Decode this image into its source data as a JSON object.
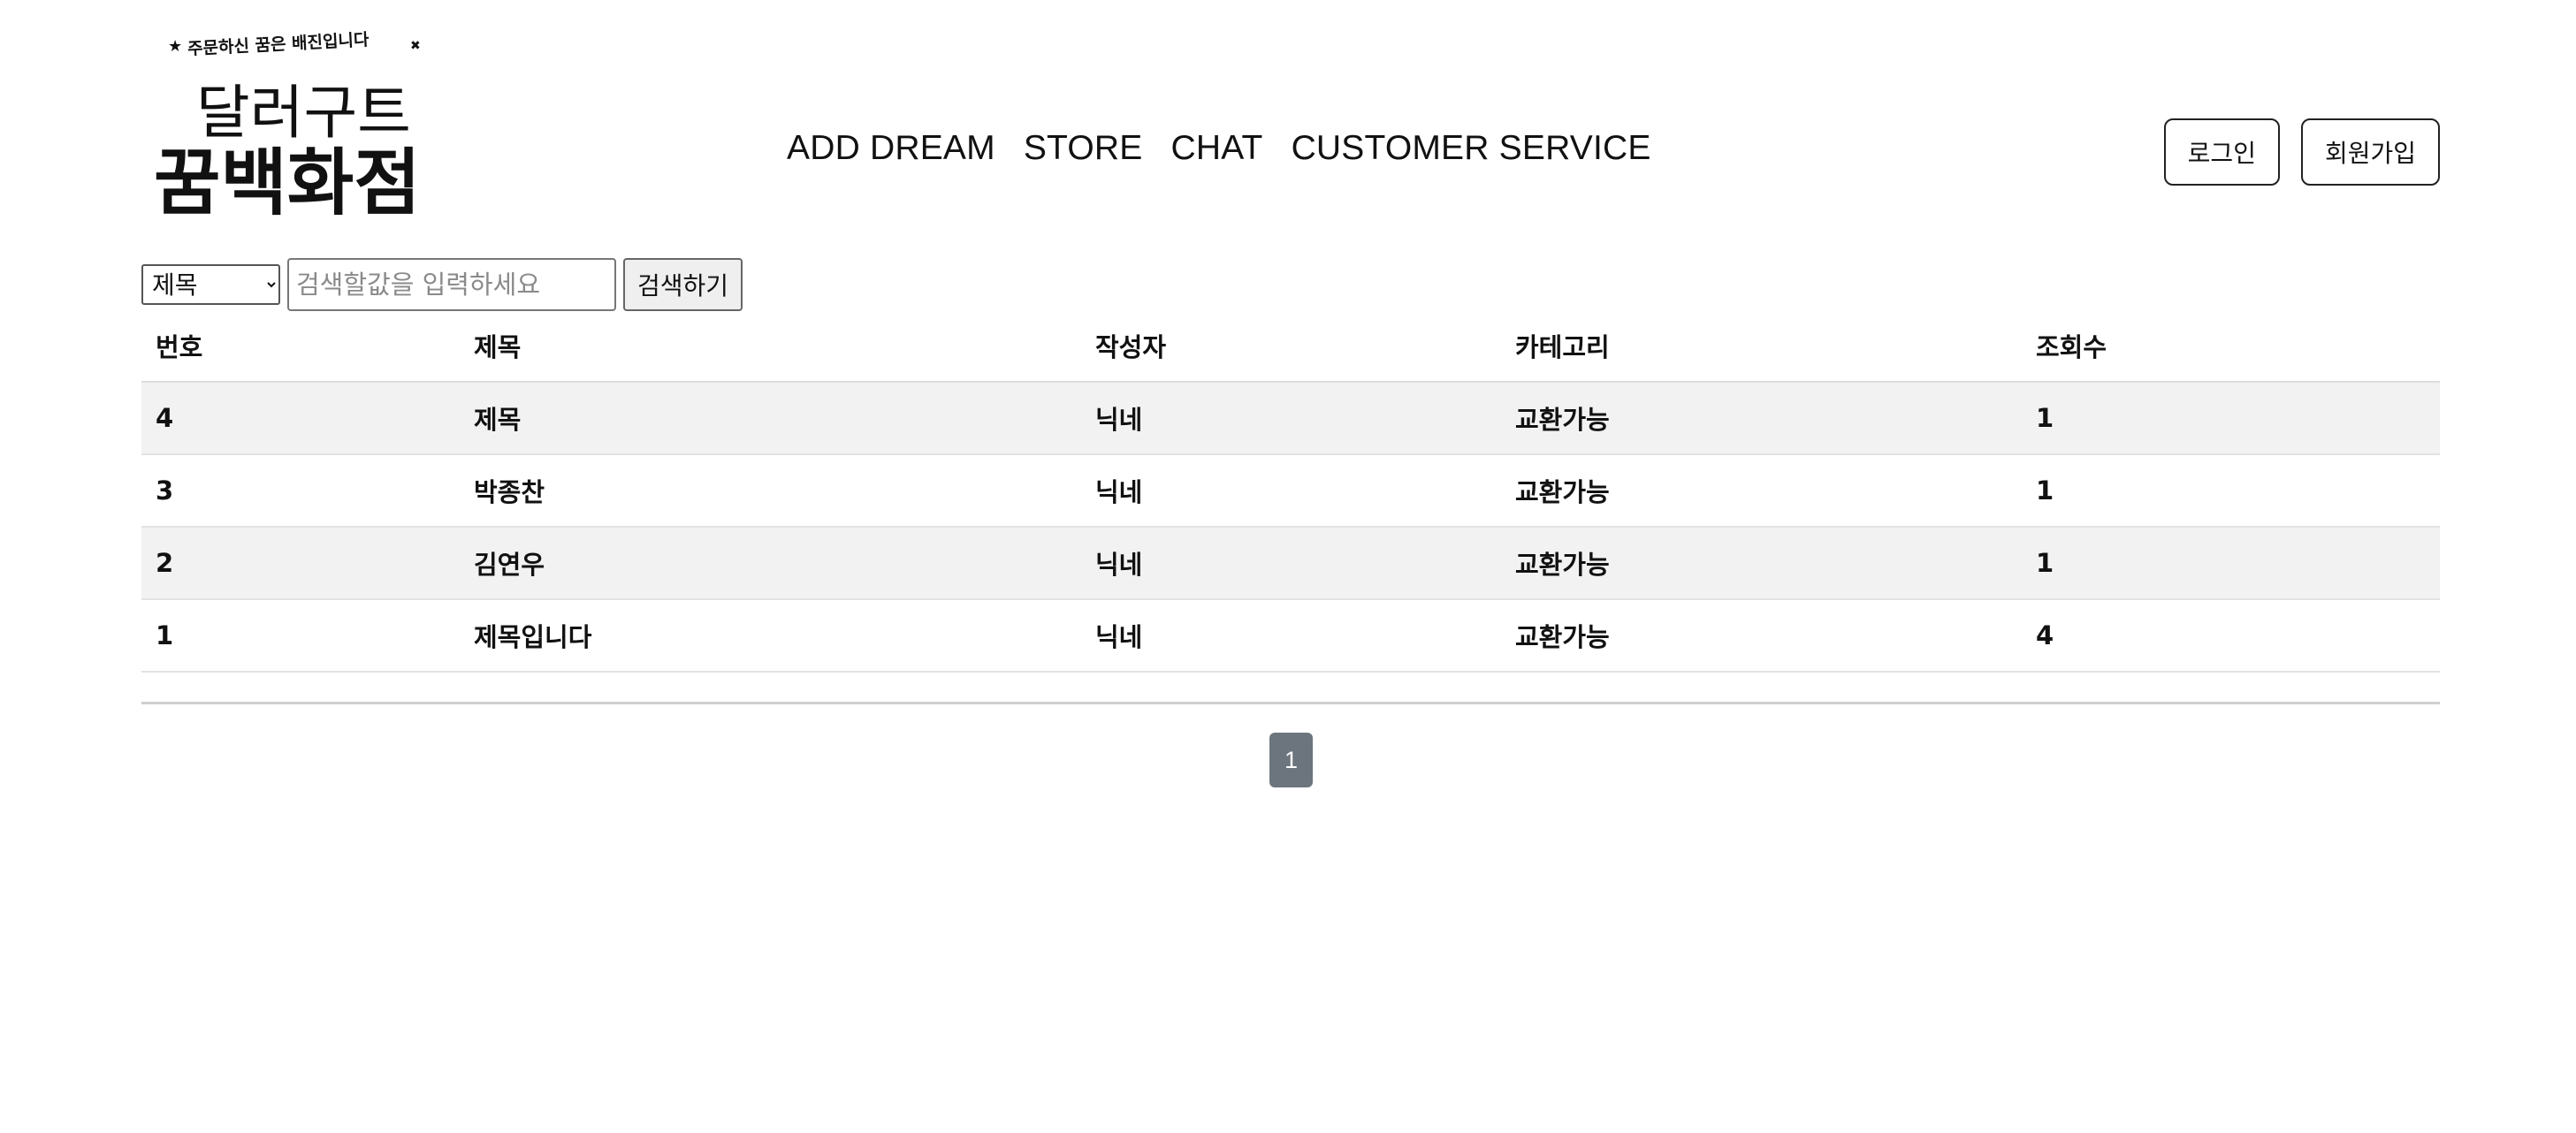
{
  "logo": {
    "tagline": "주문하신 꿈은 배진입니다",
    "line1": "달러구트",
    "line2": "꿈백화점"
  },
  "nav": {
    "items": [
      "ADD DREAM",
      "STORE",
      "CHAT",
      "CUSTOMER SERVICE"
    ]
  },
  "auth": {
    "login_label": "로그인",
    "signup_label": "회원가입"
  },
  "search": {
    "selected_option": "제목",
    "placeholder": "검색할값을 입력하세요",
    "button_label": "검색하기"
  },
  "table": {
    "headers": [
      "번호",
      "제목",
      "작성자",
      "카테고리",
      "조회수"
    ],
    "rows": [
      [
        "4",
        "제목",
        "닉네",
        "교환가능",
        "1"
      ],
      [
        "3",
        "박종찬",
        "닉네",
        "교환가능",
        "1"
      ],
      [
        "2",
        "김연우",
        "닉네",
        "교환가능",
        "1"
      ],
      [
        "1",
        "제목입니다",
        "닉네",
        "교환가능",
        "4"
      ]
    ]
  },
  "pagination": {
    "current_page": "1"
  },
  "colors": {
    "page_button": "#6c757d",
    "row_stripe": "#f2f2f2"
  }
}
